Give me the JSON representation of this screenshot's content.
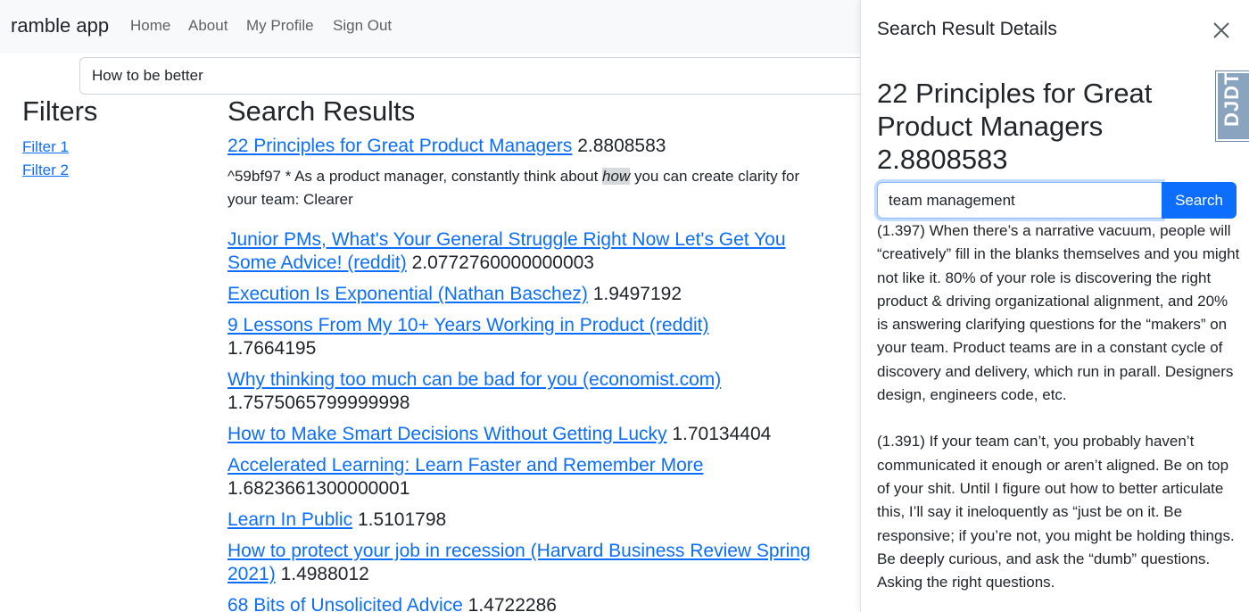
{
  "navbar": {
    "brand": "ramble app",
    "links": [
      "Home",
      "About",
      "My Profile",
      "Sign Out"
    ]
  },
  "main_search": {
    "value": "How to be better"
  },
  "filters": {
    "title": "Filters",
    "items": [
      "Filter 1",
      "Filter 2"
    ]
  },
  "results": {
    "title": "Search Results",
    "items": [
      {
        "title": "22 Principles for Great Product Managers",
        "score": "2.8808583"
      },
      {
        "title": "Junior PMs, What's Your General Struggle Right Now Let's Get You Some Advice! (reddit)",
        "score": "2.0772760000000003"
      },
      {
        "title": "Execution Is Exponential (Nathan Baschez)",
        "score": "1.9497192"
      },
      {
        "title": "9 Lessons From My 10+ Years Working in Product (reddit)",
        "score": "1.7664195"
      },
      {
        "title": "Why thinking too much can be bad for you (economist.com)",
        "score": "1.7575065799999998"
      },
      {
        "title": "How to Make Smart Decisions Without Getting Lucky",
        "score": "1.70134404"
      },
      {
        "title": "Accelerated Learning: Learn Faster and Remember More",
        "score": "1.6823661300000001"
      },
      {
        "title": "Learn In Public",
        "score": "1.5101798"
      },
      {
        "title": "How to protect your job in recession (Harvard Business Review Spring 2021)",
        "score": "1.4988012"
      },
      {
        "title": "68 Bits of Unsolicited Advice",
        "score": "1.4722286"
      }
    ],
    "snippet": {
      "before": "^59bf97 * As a product manager, constantly think about ",
      "highlight": "how",
      "after": " you can create clarity for your team: Clearer"
    }
  },
  "panel": {
    "title": "Search Result Details",
    "doc_title": "22 Principles for Great Product Managers 2.8808583",
    "badge": "DJDT",
    "search_value": "team management",
    "search_button": "Search",
    "passages": [
      "(1.397) When there’s a narrative vacuum, people will “creatively” fill in the blanks themselves and you might not like it. 80% of your role is discovering the right product & driving organizational alignment, and 20% is answering clarifying questions for the “makers” on your team. Product teams are in a constant cycle of discovery and delivery, which run in parall. Designers design, engineers code, etc.",
      "(1.391) If your team can’t, you probably haven’t communicated it enough or aren’t aligned. Be on top of your shit. Until I figure out how to better articulate this, I’ll say it ineloquently as “just be on it. Be responsive; if you’re not, you might be holding things. Be deeply curious, and ask the “dumb” questions. Asking the right questions."
    ]
  }
}
